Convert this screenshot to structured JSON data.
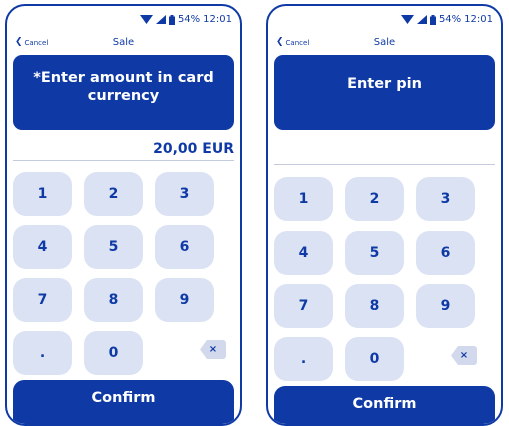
{
  "status": {
    "battery": "54%",
    "time": "12:01"
  },
  "colors": {
    "primary": "#0f3aa6",
    "key_bg": "#dbe2f3"
  },
  "icons": {
    "wifi": "wifi-icon",
    "signal": "signal-icon",
    "battery": "battery-icon",
    "back": "chevron-left-icon",
    "backspace": "backspace-icon"
  },
  "screens": [
    {
      "cancel": "Cancel",
      "title": "Sale",
      "prompt": "*Enter amount in card currency",
      "amount": "20,00 EUR",
      "keys": [
        "1",
        "2",
        "3",
        "4",
        "5",
        "6",
        "7",
        "8",
        "9",
        ".",
        "0"
      ],
      "backspace": "×",
      "confirm": "Confirm"
    },
    {
      "cancel": "Cancel",
      "title": "Sale",
      "prompt": "Enter pin",
      "amount": "",
      "keys": [
        "1",
        "2",
        "3",
        "4",
        "5",
        "6",
        "7",
        "8",
        "9",
        ".",
        "0"
      ],
      "backspace": "×",
      "confirm": "Confirm"
    }
  ]
}
